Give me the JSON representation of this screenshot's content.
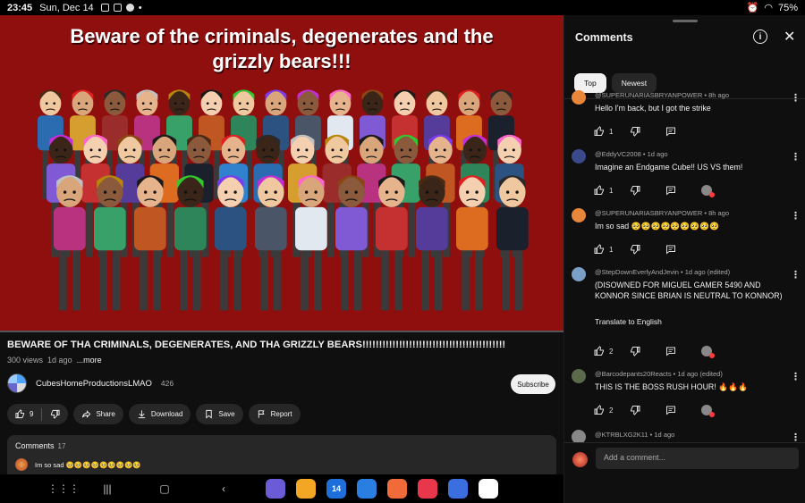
{
  "status_bar": {
    "time": "23:45",
    "date": "Sun, Dec 14",
    "battery": "75%"
  },
  "video": {
    "overlay_title_line1": "Beware of the criminals, degenerates and the",
    "overlay_title_line2": "grizzly bears!!!",
    "title": "BEWARE OF THA CRIMINALS, DEGENERATES, AND THA GRIZZLY BEARS!!!!!!!!!!!!!!!!!!!!!!!!!!!!!!!!!!!!!!!!!!!",
    "views": "300 views",
    "age": "1d ago",
    "more": "...more",
    "colors": {
      "background": "#8f0f0f"
    }
  },
  "channel": {
    "name": "CubesHomeProductionsLMAO",
    "subscribers": "426",
    "subscribe_label": "Subscribe"
  },
  "actions": {
    "like_count": "9",
    "share": "Share",
    "download": "Download",
    "save": "Save",
    "report": "Report"
  },
  "comments_card": {
    "label": "Comments",
    "count": "17",
    "preview_text": "Im so sad 🥺🥺🥺🥺🥺🥺🥺🥺🥺"
  },
  "panel": {
    "title": "Comments",
    "tabs": [
      "Top",
      "Newest"
    ],
    "comments": [
      {
        "author": "@SUPERUNARIASBRYANPOWER",
        "time": "8h ago",
        "text": "Hello I'm back, but I got the strike",
        "likes": "1",
        "color": "#e8863a"
      },
      {
        "author": "@EddyVC2008",
        "time": "1d ago",
        "text": "Imagine an Endgame Cube!! US VS them!",
        "likes": "1",
        "color": "#3a4a8a"
      },
      {
        "author": "@SUPERUNARIASBRYANPOWER",
        "time": "8h ago",
        "text": "Im so sad 🥺🥺🥺🥺🥺🥺🥺🥺🥺",
        "likes": "1",
        "color": "#e8863a"
      },
      {
        "author": "@StepDownEverlyAndJevin",
        "time": "1d ago (edited)",
        "text": "(DISOWNED FOR MIGUEL GAMER 5490 AND KONNOR SINCE BRIAN IS NEUTRAL TO KONNOR)",
        "translate": "Translate to English",
        "likes": "2",
        "color": "#7aa0c8"
      },
      {
        "author": "@Barcodepants20Reacts",
        "time": "1d ago (edited)",
        "text": "THIS IS THE BOSS RUSH HOUR! 🔥🔥🔥",
        "likes": "2",
        "color": "#5a6a4a"
      },
      {
        "author": "@KTRBLXG2K11",
        "time": "1d ago",
        "text": "",
        "likes": "",
        "color": "#888888"
      }
    ],
    "add_comment_placeholder": "Add a comment..."
  },
  "navbar": {
    "apps": [
      {
        "name": "browser-app",
        "color": "#6b5bd6",
        "label": ""
      },
      {
        "name": "files-app",
        "color": "#f2a623",
        "label": ""
      },
      {
        "name": "calendar-app",
        "color": "#1e6fd9",
        "label": "14"
      },
      {
        "name": "messages-app",
        "color": "#2a7de1",
        "label": ""
      },
      {
        "name": "contacts-app",
        "color": "#f06a3a",
        "label": ""
      },
      {
        "name": "camera-app",
        "color": "#e8374a",
        "label": ""
      },
      {
        "name": "roblox-app",
        "color": "#3b6fe0",
        "label": ""
      },
      {
        "name": "chrome-app",
        "color": "#ffffff",
        "label": ""
      }
    ]
  }
}
